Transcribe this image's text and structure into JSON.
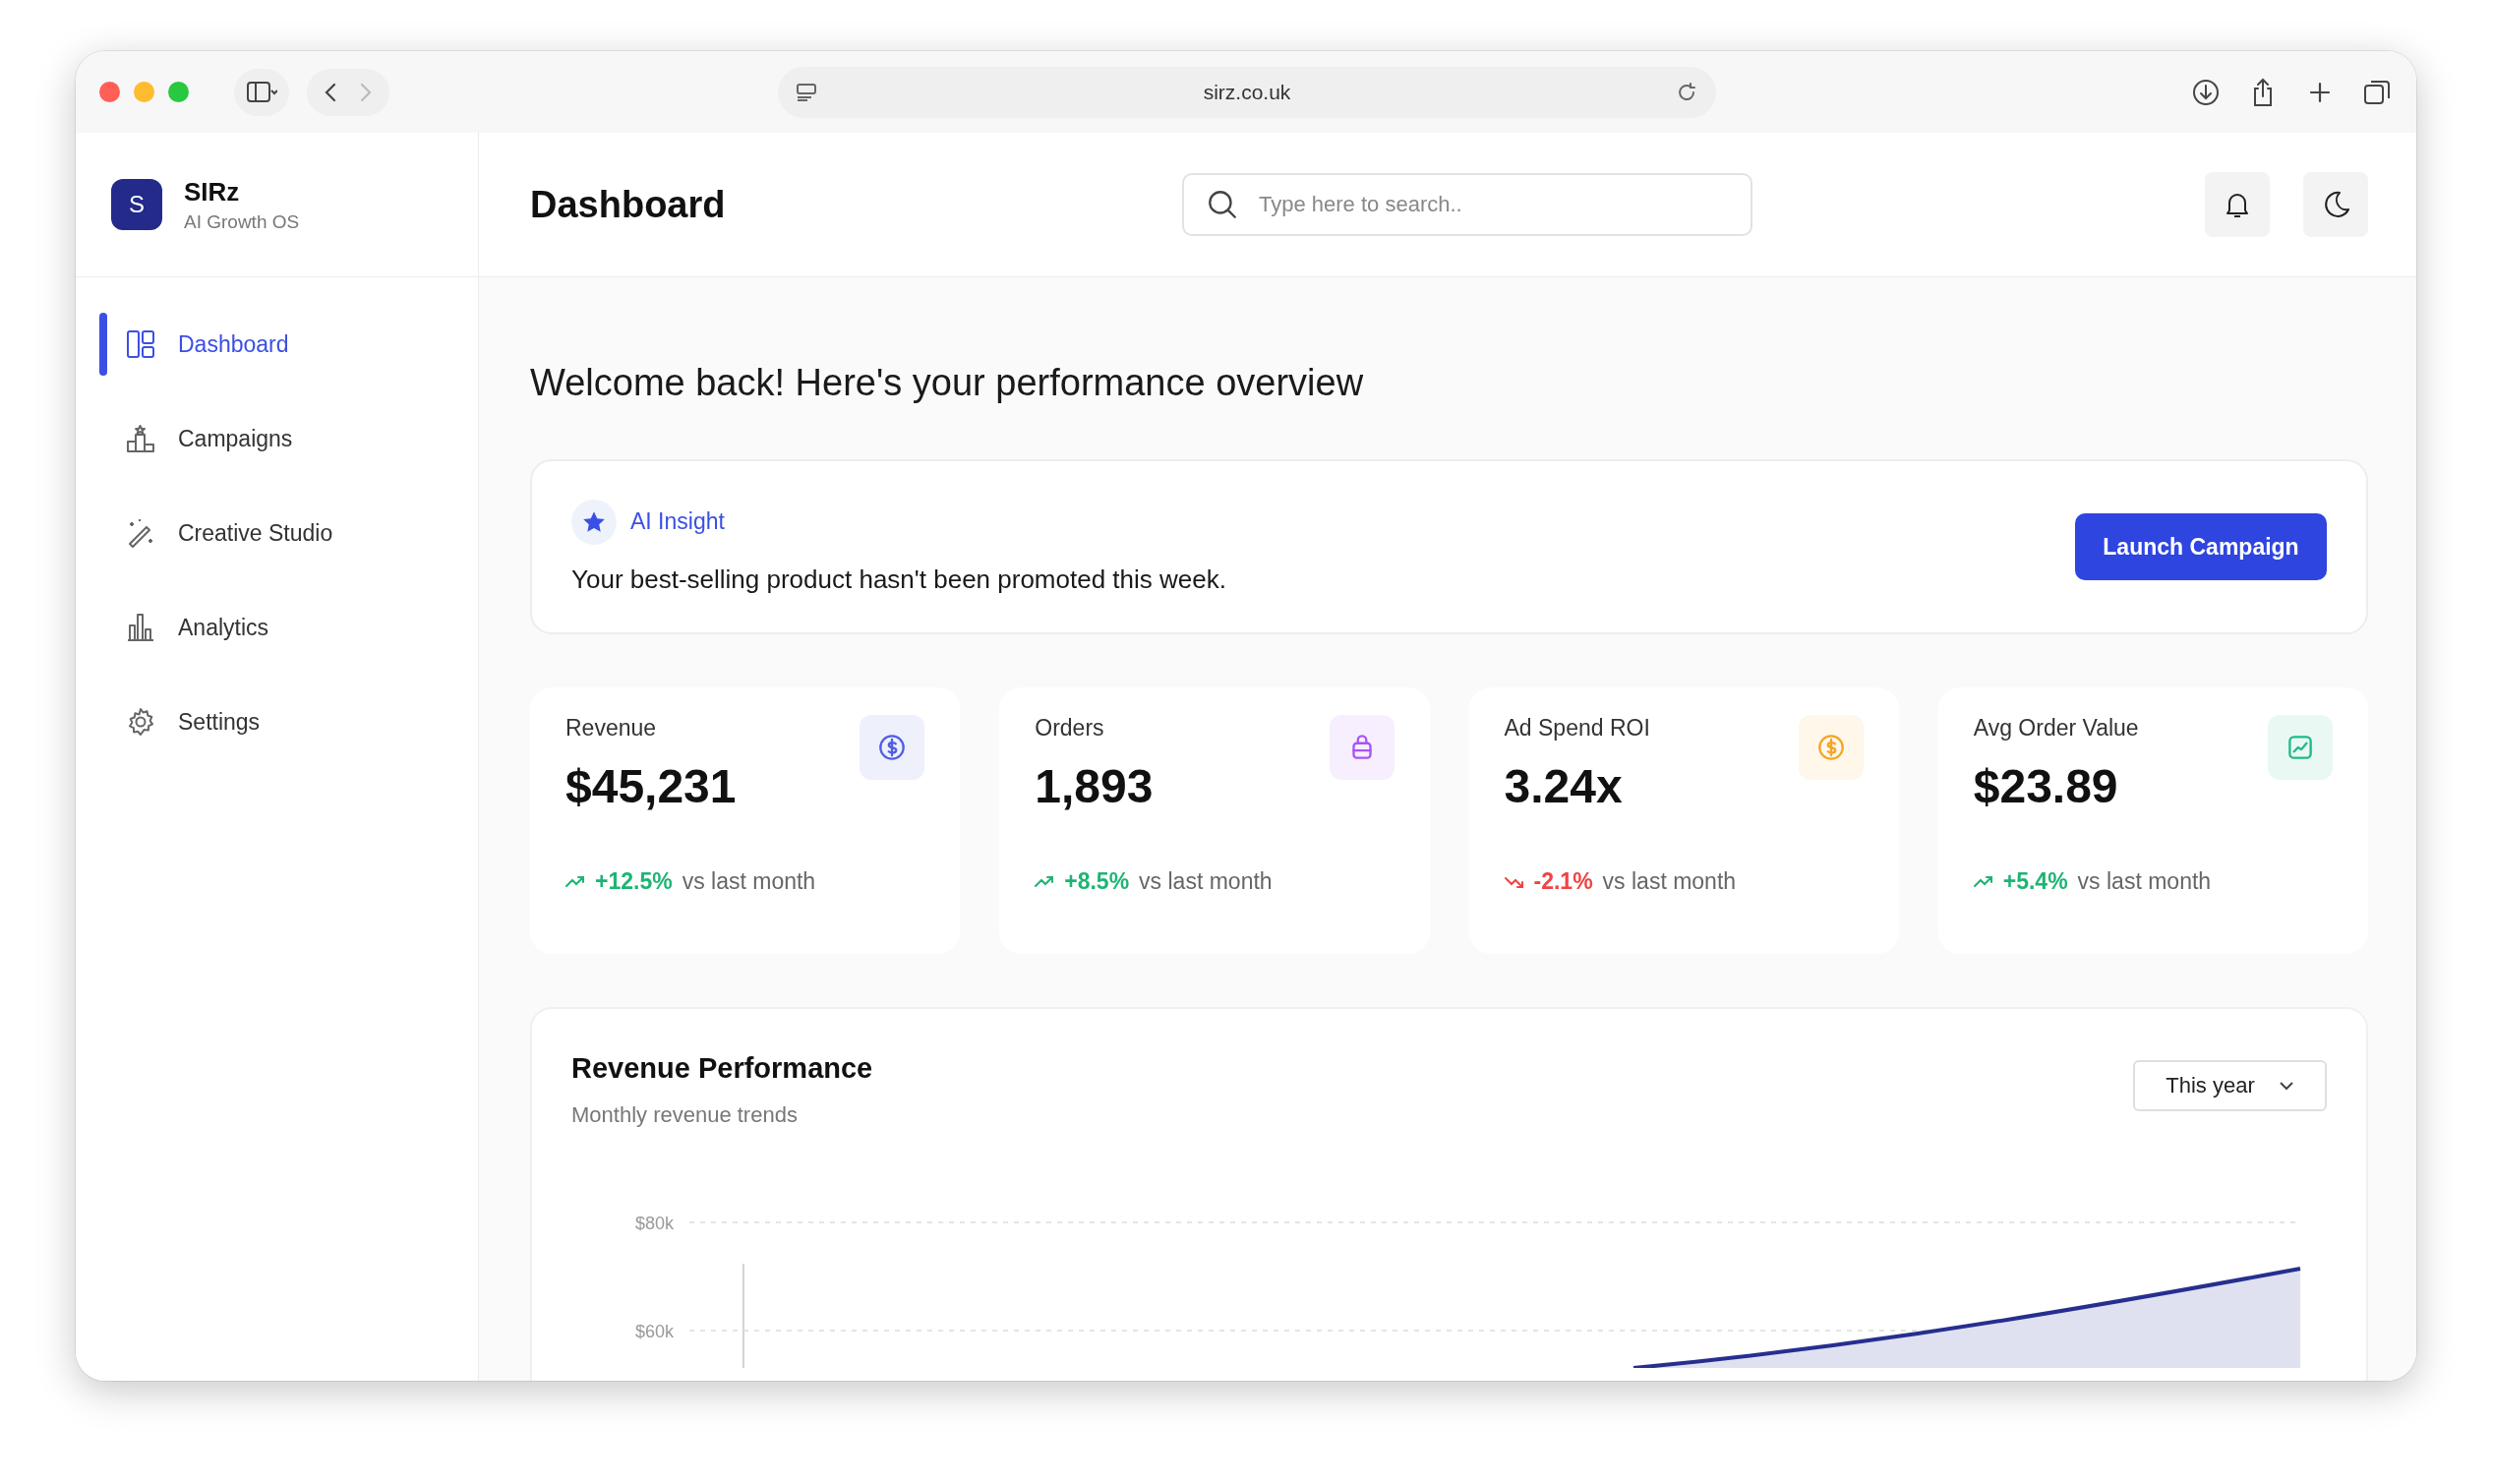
{
  "browser": {
    "url": "sirz.co.uk"
  },
  "brand": {
    "logo_letter": "S",
    "name": "SIRz",
    "tagline": "AI Growth OS"
  },
  "sidebar": {
    "items": [
      {
        "label": "Dashboard",
        "selected": true
      },
      {
        "label": "Campaigns",
        "selected": false
      },
      {
        "label": "Creative Studio",
        "selected": false
      },
      {
        "label": "Analytics",
        "selected": false
      },
      {
        "label": "Settings",
        "selected": false
      }
    ]
  },
  "header": {
    "title": "Dashboard",
    "search": {
      "placeholder": "Type here to search.."
    }
  },
  "welcome": "Welcome back! Here's your performance overview",
  "insight": {
    "label": "AI Insight",
    "message": "Your best-selling product hasn't been promoted this week.",
    "button": "Launch Campaign"
  },
  "stats": [
    {
      "label": "Revenue",
      "value": "$45,231",
      "change": "+12.5%",
      "kind": "up",
      "note": "vs last month",
      "color": "#4f5fe0"
    },
    {
      "label": "Orders",
      "value": "1,893",
      "change": "+8.5%",
      "kind": "up",
      "note": "vs last month",
      "color": "#a855f7"
    },
    {
      "label": "Ad Spend ROI",
      "value": "3.24x",
      "change": "-2.1%",
      "kind": "down",
      "note": "vs last month",
      "color": "#f5a524"
    },
    {
      "label": "Avg Order Value",
      "value": "$23.89",
      "change": "+5.4%",
      "kind": "up",
      "note": "vs last month",
      "color": "#1fb98a"
    }
  ],
  "revenue_chart": {
    "title": "Revenue Performance",
    "subtitle": "Monthly revenue trends",
    "period": "This year",
    "y_axis_labels": [
      "$80k",
      "$60k"
    ]
  }
}
